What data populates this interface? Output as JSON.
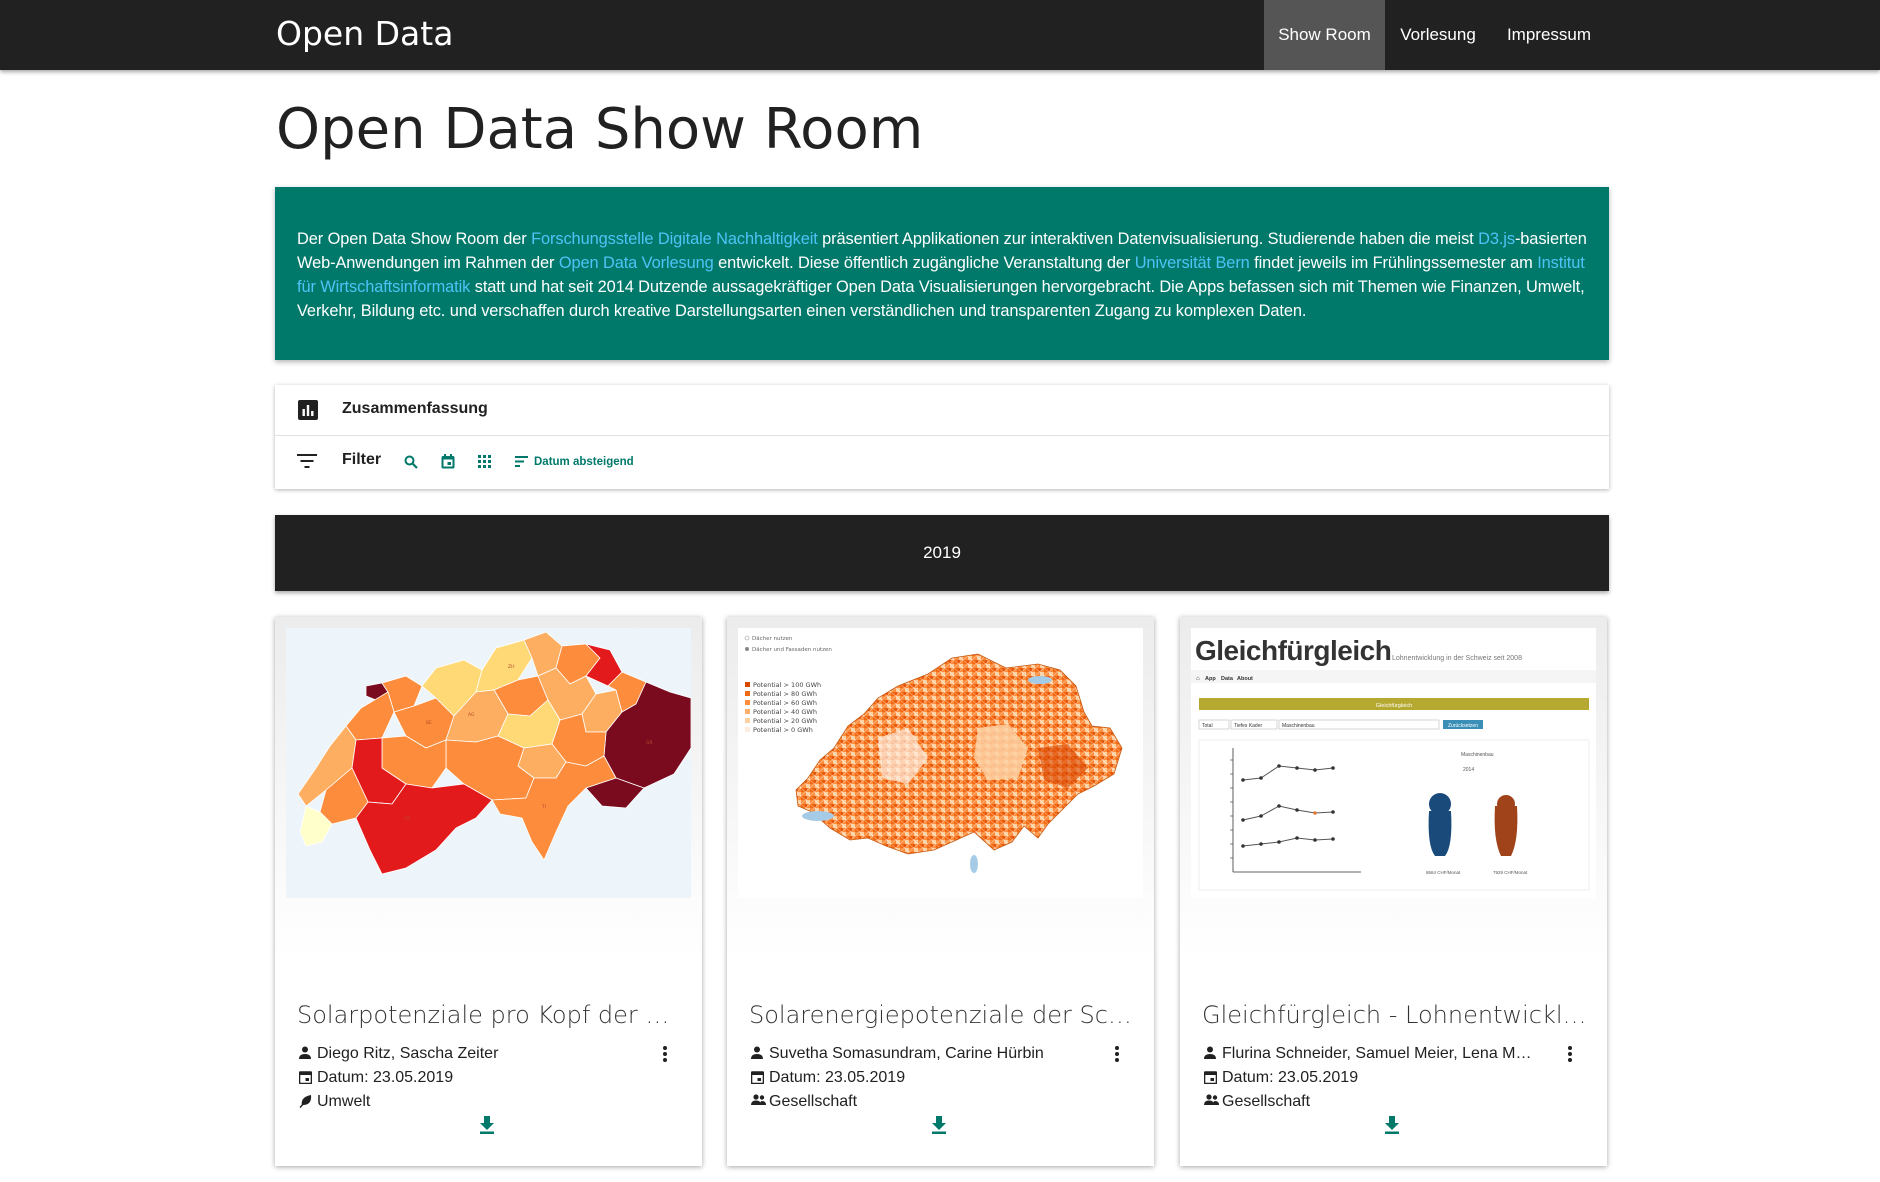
{
  "navbar": {
    "brand": "Open Data",
    "items": [
      {
        "label": "Show Room",
        "active": true
      },
      {
        "label": "Vorlesung",
        "active": false
      },
      {
        "label": "Impressum",
        "active": false
      }
    ]
  },
  "page": {
    "title": "Open Data Show Room"
  },
  "intro": {
    "t1": "Der Open Data Show Room der ",
    "l1": "Forschungsstelle Digitale Nachhaltigkeit",
    "t2": " präsentiert Applikationen zur interaktiven Datenvisualisierung. Studierende haben die meist ",
    "l2": "D3.js",
    "t3": "-basierten Web-Anwendungen im Rahmen der ",
    "l3": "Open Data Vorlesung",
    "t4": " entwickelt. Diese öffentlich zugängliche Veranstaltung der ",
    "l4": "Universität Bern",
    "t5": " findet jeweils im Frühlingssemester am ",
    "l5": "Institut für Wirtschaftsinformatik",
    "t6": " statt und hat seit 2014 Dutzende aussagekräftiger Open Data Visualisierungen hervorgebracht. Die Apps befassen sich mit Themen wie Finanzen, Umwelt, Verkehr, Bildung etc. und verschaffen durch kreative Darstellungsarten einen verständlichen und transparenten Zugang zu komplexen Daten."
  },
  "toolbar": {
    "summary_label": "Zusammenfassung",
    "filter_label": "Filter",
    "sort_label": "Datum absteigend"
  },
  "year_label": "2019",
  "cards": [
    {
      "title": "Solarpotenziale pro Kopf der Schweiz",
      "authors": "Diego Ritz, Sascha Zeiter",
      "date": "Datum: 23.05.2019",
      "category": "Umwelt",
      "category_icon": "leaf-icon"
    },
    {
      "title": "Solarenergiepotenziale der Schweizer Gemeinden",
      "authors": "Suvetha Somasundram, Carine Hürbin",
      "date": "Datum: 23.05.2019",
      "category": "Gesellschaft",
      "category_icon": "people-icon",
      "legend": [
        "Dächer nutzen",
        "Dächer und Fassaden nutzen"
      ],
      "legend_items": [
        "Potential > 100 GWh",
        "Potential > 80 GWh",
        "Potential > 60 GWh",
        "Potential > 40 GWh",
        "Potential > 20 GWh",
        "Potential > 0 GWh"
      ]
    },
    {
      "title": "Gleichfürgleich - Lohnentwicklung in der Schweiz",
      "authors": "Flurina Schneider, Samuel Meier, Lena Moser",
      "date": "Datum: 23.05.2019",
      "category": "Gesellschaft",
      "category_icon": "people-icon",
      "app_title": "Gleichfürgleich",
      "app_subtitle": "Lohnentwicklung in der Schweiz seit 2008",
      "app_nav": [
        "App",
        "Data",
        "About"
      ],
      "app_banner": "Gleichfürgleich",
      "app_selects": [
        "Total",
        "Tiefes Kader",
        "Maschinenbau"
      ],
      "app_button": "Zurücksetzen",
      "app_chart_label": "Maschinenbau",
      "app_year": "2014",
      "app_left_value": "8664 CHF/Monat",
      "app_right_value": "7929 CHF/Monat"
    }
  ],
  "colors": {
    "navbar": "#212121",
    "teal": "#00796b",
    "link": "#4fc3f7"
  }
}
